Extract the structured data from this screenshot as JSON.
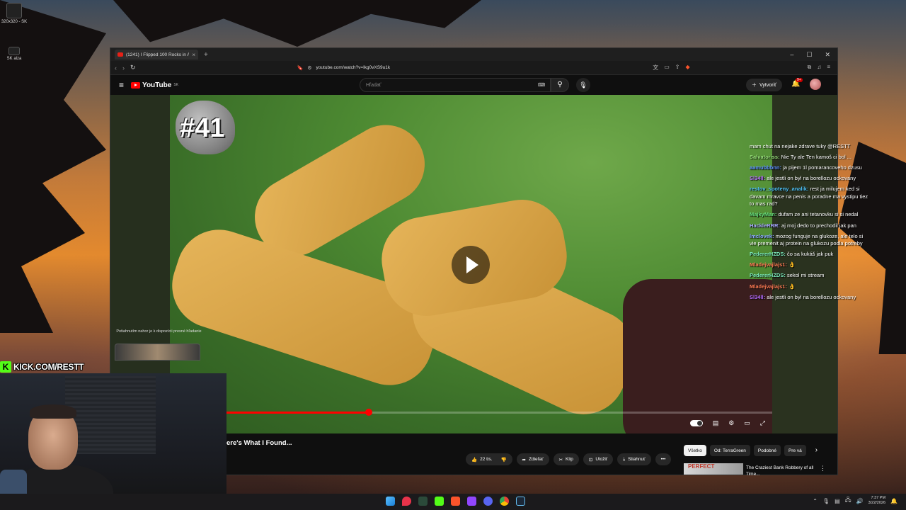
{
  "desktop": {
    "icon1_label": "",
    "icon1_sub": "320x320 - SK",
    "icon2_label": "SK alza"
  },
  "browser": {
    "tab_title": "(1241) I Flipped 100 Rocks in Au",
    "url": "youtube.com/watch?v=lkg0vXS9u1k"
  },
  "youtube": {
    "logo_text": "YouTube",
    "logo_region": "SK",
    "search_placeholder": "Hľadať",
    "create_label": "Vytvoriť",
    "notification_count": "9+",
    "video_overlay_number": "#41",
    "progress_fraction": 0.33,
    "video_title": "ere's What I Found...",
    "actions": {
      "likes": "22 tis.",
      "share": "Zdieľať",
      "clip": "Klip",
      "save": "Uložiť",
      "download": "Stiahnuť"
    },
    "chips": [
      "Všetko",
      "Od: TerraGreen",
      "Podobné",
      "Pre vá"
    ],
    "recommendation": {
      "thumb_text": "PERFECT",
      "title": "The Craziest Bank Robbery of all Time..."
    }
  },
  "chat": [
    {
      "nick": "",
      "text": "mam chut na nejake zdrave tuky @RESTT",
      "color": "#ffffff"
    },
    {
      "nick": "Salvatoriss:",
      "text": "Nie Ty ale Ten kamoš ci bol ...",
      "color": "#9be37d"
    },
    {
      "nick": "aamubbbnn:",
      "text": "ja pijem 1l pomarancoveho dzusu",
      "color": "#5b8cff"
    },
    {
      "nick": "Sl34ll:",
      "text": "ale jestli on byl na borellozu ockovany",
      "color": "#b66bff"
    },
    {
      "nick": "restov_spoteny_analik:",
      "text": "rest ja milujem ked si davam mravce na penis a poradne ma vystipu tiez to mas rad?",
      "color": "#4fc3f7"
    },
    {
      "nick": "MajkyMan:",
      "text": "dufam ze ani tetanovku si si nedal",
      "color": "#67e07e"
    },
    {
      "nick": "HackleRRR:",
      "text": "aj moj dedo to prechodil jak pan",
      "color": "#a7a7ff"
    },
    {
      "nick": "lmclovek:",
      "text": "mozog funguje na glukoze, ale telo si vie premenit aj protein na glukozu podla potreby",
      "color": "#8aa6ff"
    },
    {
      "nick": "PedererHZDS:",
      "text": "čo sa kukáš jak puk",
      "color": "#7ef0c0"
    },
    {
      "nick": "Mladejvajlajs1:",
      "text": "👌",
      "color": "#ff7b54"
    },
    {
      "nick": "PedererHZDS:",
      "text": "sekol mi stream",
      "color": "#7ef0c0"
    },
    {
      "nick": "Mladejvajlajs1:",
      "text": "👌",
      "color": "#ff7b54"
    },
    {
      "nick": "Sl34ll:",
      "text": "ale jestli on byl na borellozu ockovany",
      "color": "#b66bff"
    }
  ],
  "overlay": {
    "cam_hint": "Potiahnutím nahor je k dispozícii presné hľadanie",
    "kick_label": "KICK.COM/RESTT"
  },
  "taskbar": {
    "time": "7:37 PM",
    "date": "3/22/2026"
  },
  "colors": {
    "yt_red": "#ff0000",
    "kick_green": "#53fc18"
  }
}
